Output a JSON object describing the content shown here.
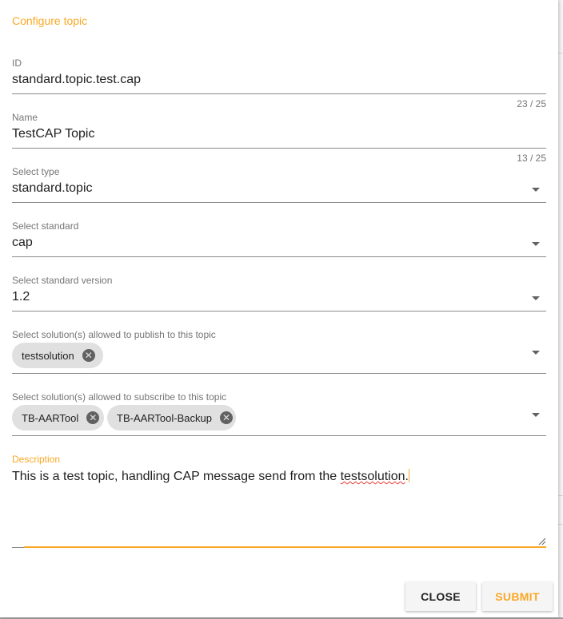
{
  "dialog": {
    "title": "Configure topic"
  },
  "fields": {
    "id": {
      "label": "ID",
      "value": "standard.topic.test.cap",
      "counter": "23 / 25"
    },
    "name": {
      "label": "Name",
      "value": "TestCAP Topic",
      "counter": "13 / 25"
    },
    "type": {
      "label": "Select type",
      "value": "standard.topic"
    },
    "standard": {
      "label": "Select standard",
      "value": "cap"
    },
    "version": {
      "label": "Select standard version",
      "value": "1.2"
    },
    "publish": {
      "label": "Select solution(s) allowed to publish to this topic",
      "chips": [
        "testsolution"
      ]
    },
    "subscribe": {
      "label": "Select solution(s) allowed to subscribe to this topic",
      "chips": [
        "TB-AARTool",
        "TB-AARTool-Backup"
      ]
    },
    "description": {
      "label": "Description",
      "text_before": "This is a test topic, handling CAP message send from the ",
      "misspelled": "testsolution",
      "text_after": "."
    }
  },
  "actions": {
    "close_label": "CLOSE",
    "submit_label": "SUBMIT"
  },
  "icons": {
    "dropdown": "chevron-down-icon",
    "chip_remove": "cancel-circle-icon",
    "resize": "resize-handle-icon"
  },
  "colors": {
    "accent": "#f9a825",
    "chip_bg": "#e0e0e0",
    "text": "#212121",
    "label": "#757575"
  }
}
